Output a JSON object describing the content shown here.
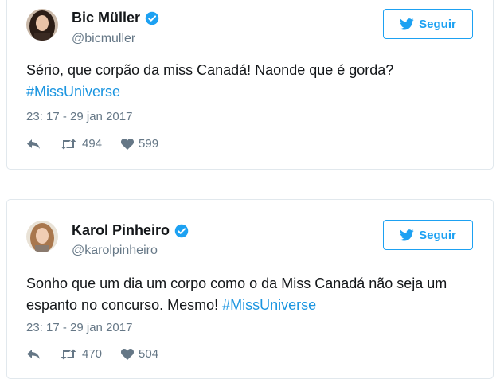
{
  "tweets": [
    {
      "name": "Bic Müller",
      "handle": "@bicmuller",
      "verified": true,
      "follow_label": "Seguir",
      "text_before": "Sério, que corpão da miss Canadá! Naonde que é gorda?",
      "hashtag": "#MissUniverse",
      "timestamp": "23: 17 - 29 jan 2017",
      "retweets": "494",
      "likes": "599",
      "avatar_icon": "avatar-photo-dark-hair"
    },
    {
      "name": "Karol Pinheiro",
      "handle": "@karolpinheiro",
      "verified": true,
      "follow_label": "Seguir",
      "text_before": "Sonho que um dia um corpo como o da Miss Canadá não seja um espanto no concurso. Mesmo!",
      "hashtag": "#MissUniverse",
      "timestamp": "23: 17 - 29 jan 2017",
      "retweets": "470",
      "likes": "504",
      "avatar_icon": "avatar-photo-light-hair"
    }
  ],
  "colors": {
    "accent": "#1da1f2",
    "hashtag": "#1b95e0",
    "muted": "#657786",
    "border": "#e1e8ed",
    "text": "#14171a"
  },
  "icons": [
    "verified-badge-icon",
    "twitter-bird-icon",
    "reply-icon",
    "retweet-icon",
    "heart-icon"
  ]
}
